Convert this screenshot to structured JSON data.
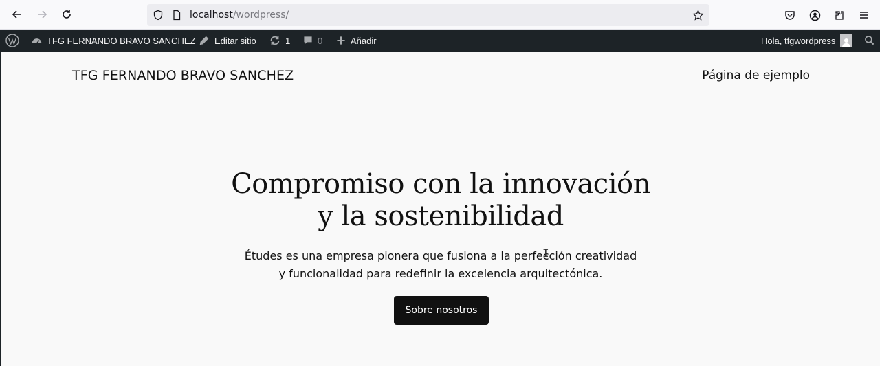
{
  "browser": {
    "url_host": "localhost",
    "url_path": "/wordpress/",
    "icons": {
      "back": "back-arrow-icon",
      "forward": "forward-arrow-icon",
      "reload": "reload-icon",
      "shield": "tracking-protection-icon",
      "page": "page-info-icon",
      "bookmark": "bookmark-star-icon",
      "pocket": "pocket-icon",
      "account": "account-icon",
      "extensions": "extensions-icon",
      "menu": "hamburger-menu-icon"
    }
  },
  "admin_bar": {
    "site_name": "TFG FERNANDO BRAVO SANCHEZ",
    "edit_site": "Editar sitio",
    "updates_count": "1",
    "comments_count": "0",
    "add_new": "Añadir",
    "greeting": "Hola, tfgwordpress"
  },
  "site": {
    "title": "TFG FERNANDO BRAVO SANCHEZ",
    "nav_item": "Página de ejemplo"
  },
  "hero": {
    "title_line1": "Compromiso con la innovación",
    "title_line2": "y la sostenibilidad",
    "subtitle_line1": "Études es una empresa pionera que fusiona a la perfección creatividad",
    "subtitle_line2": "y funcionalidad para redefinir la excelencia arquitectónica.",
    "button_label": "Sobre nosotros"
  },
  "colors": {
    "admin_bar_bg": "#1d2327",
    "page_bg": "#f9f9f9",
    "button_bg": "#111111"
  }
}
